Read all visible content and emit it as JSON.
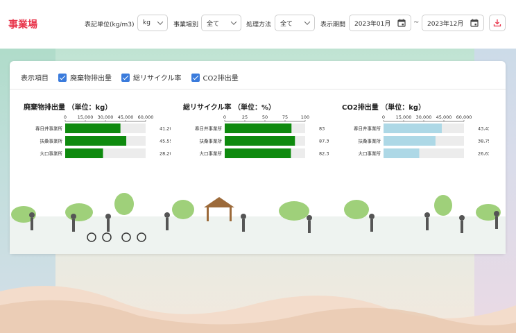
{
  "header": {
    "title": "事業場",
    "unit_label": "表記単位(kg/m3)",
    "unit_value": "kg",
    "site_type_label": "事業場別",
    "site_type_value": "全て",
    "method_label": "処理方法",
    "method_value": "全て",
    "period_label": "表示期間",
    "period_start": "2023年01月",
    "period_sep": "~",
    "period_end": "2023年12月"
  },
  "filters": {
    "label": "表示項目",
    "items": [
      {
        "label": "廃棄物排出量",
        "checked": true
      },
      {
        "label": "総リサイクル率",
        "checked": true
      },
      {
        "label": "CO2排出量",
        "checked": true
      }
    ]
  },
  "charts": [
    {
      "title": "廃棄物排出量 （単位：kg）"
    },
    {
      "title": "総リサイクル率 （単位：%）"
    },
    {
      "title": "CO2排出量 （単位：kg）"
    }
  ],
  "chart_data": [
    {
      "type": "bar",
      "title": "廃棄物排出量 （単位：kg）",
      "categories": [
        "春日井事業所",
        "扶桑事業所",
        "大口事業所"
      ],
      "values": [
        41200,
        45550,
        28200
      ],
      "value_labels": [
        "41,200",
        "45,550",
        "28,200"
      ],
      "xlim": [
        0,
        60000
      ],
      "ticks": [
        "0",
        "15,000",
        "30,000",
        "45,000",
        "60,000"
      ],
      "color": "#0e8a0e"
    },
    {
      "type": "bar",
      "title": "総リサイクル率 （単位：%）",
      "categories": [
        "春日井事業所",
        "扶桑事業所",
        "大口事業所"
      ],
      "values": [
        83,
        87.3,
        82.3
      ],
      "value_labels": [
        "83",
        "87.3",
        "82.3"
      ],
      "xlim": [
        0,
        100
      ],
      "ticks": [
        "0",
        "25",
        "50",
        "75",
        "100"
      ],
      "color": "#0e8a0e"
    },
    {
      "type": "bar",
      "title": "CO2排出量 （単位：kg）",
      "categories": [
        "春日井事業所",
        "扶桑事業所",
        "大口事業所"
      ],
      "values": [
        43435,
        38755,
        26635
      ],
      "value_labels": [
        "43,435",
        "38,755",
        "26,635"
      ],
      "xlim": [
        0,
        60000
      ],
      "ticks": [
        "0",
        "15,000",
        "30,000",
        "45,000",
        "60,000"
      ],
      "color": "#add8e6"
    }
  ]
}
